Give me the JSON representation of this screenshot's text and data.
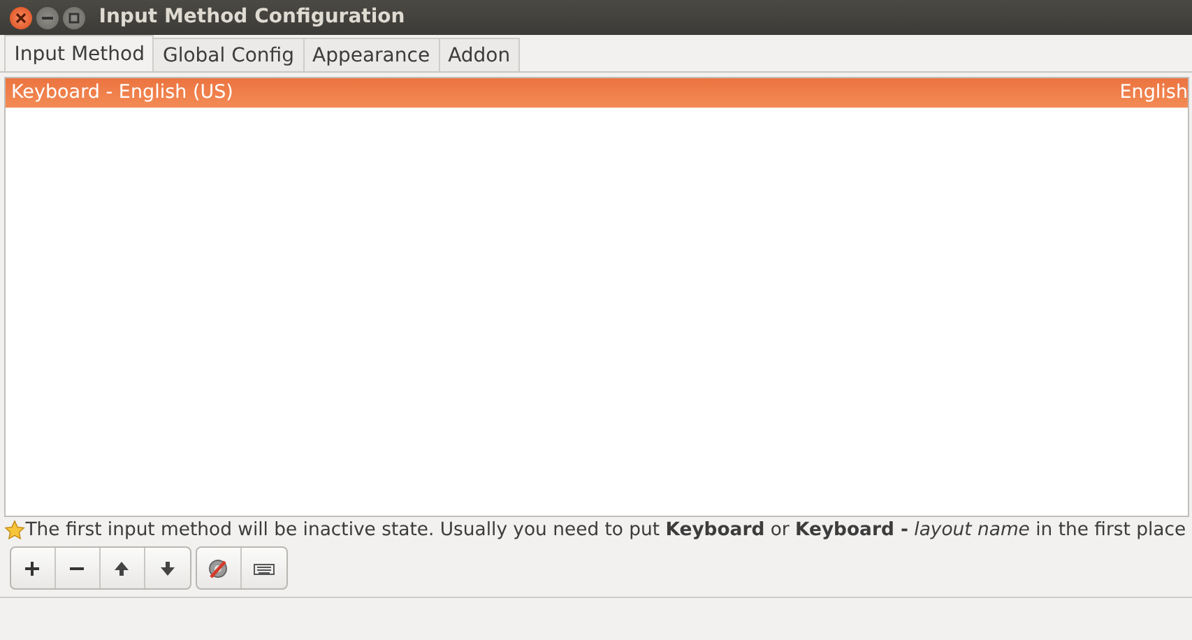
{
  "window": {
    "title": "Input Method Configuration"
  },
  "tabs": [
    {
      "label": "Input Method",
      "selected": true
    },
    {
      "label": "Global Config",
      "selected": false
    },
    {
      "label": "Appearance",
      "selected": false
    },
    {
      "label": "Addon",
      "selected": false
    }
  ],
  "input_methods": [
    {
      "name": "Keyboard - English (US)",
      "language": "English",
      "selected": true
    }
  ],
  "hint": {
    "text": "The first input method will be inactive state. Usually you need to put **Keyboard** or **Keyboard -** *layout name* in the first place"
  },
  "toolbar": [
    {
      "kind": "add"
    },
    {
      "kind": "remove"
    },
    {
      "kind": "up"
    },
    {
      "kind": "down"
    },
    {
      "kind": "configure"
    },
    {
      "kind": "keyboard"
    }
  ]
}
